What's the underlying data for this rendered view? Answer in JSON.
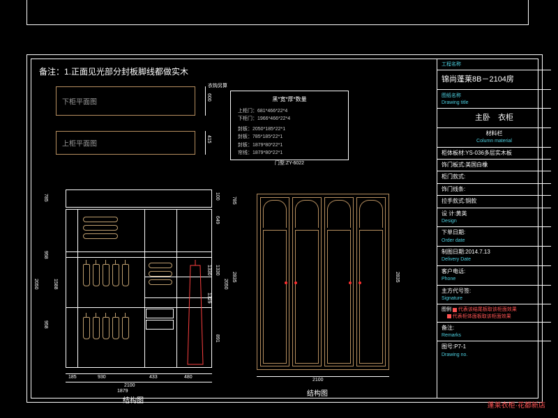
{
  "note": "备注：1.正面见光部分封板脚线都做实木",
  "plan_labels": {
    "upper": "下柜平面图",
    "lower": "上柜平面图"
  },
  "plan_dims": {
    "upper_h": "600",
    "lower_h": "415",
    "hook_note": "衣钩另算"
  },
  "spec": {
    "title": "黑*宽*厚*数量",
    "lines": [
      "上柜门：681*466*22*4",
      "下柜门：1966*466*22*4",
      "封板：2050*185*22*1",
      "封板：785*185*22*1",
      "封板：1879*80*22*1",
      "帘线：1879*80*22*1"
    ],
    "footer": "门型:ZY-6022"
  },
  "elev_left": {
    "title": "结构图",
    "total_h": "2050",
    "top_h": "785",
    "row_h": "958",
    "row_h2": "958",
    "w_a": "185",
    "w_b": "930",
    "w_c": "433",
    "w_d": "480",
    "total_w": "2100",
    "inner_w": "1879",
    "h_right_seq": [
      "100",
      "649",
      "1330",
      "2050",
      "891",
      "1329",
      "1330"
    ],
    "h_left_extra": "1588",
    "overall": "2835",
    "top_gap": "785"
  },
  "elev_right": {
    "title": "结构图",
    "width": "2100",
    "height": "2835"
  },
  "titleblock": {
    "project_lbl": "工程名称",
    "project": "锦尚蓬莱8B－2104房",
    "drawing_lbl": "图纸名称",
    "drawing_lbl_en": "Drawing title",
    "drawing": "主卧　衣柜",
    "material_lbl": "材料栏",
    "material_lbl_en": "Column material",
    "material": "柜体板材:YS-036多层实木板",
    "door_mat": "饰门板式:美国白橡",
    "door_style_lbl": "柜门款式:",
    "door_line_lbl": "饰门线条:",
    "handle": "拉手款式:铜款",
    "design_lbl": "设 计:黄英",
    "design_lbl_en": "Design",
    "order_lbl": "下单日期:",
    "order_lbl_en": "Order date",
    "delivery": "制图日期:2014.7.13",
    "delivery_en": "Delivery Date",
    "phone_lbl": "客户电话:",
    "phone_en": "Phone",
    "sign_lbl": "主方代号签:",
    "sign_en": "Signature",
    "legend1": "代表该结尾板取该柜面效果",
    "legend2": "代表柜体面板取该柜面效果",
    "legend_lbl": "图例",
    "remarks_lbl": "备注:",
    "remarks_en": "Remarks",
    "dwgno": "图号:P7-1",
    "dwgno_en": "Drawing no."
  },
  "brand": "蓬莱衣柜·花都新店"
}
